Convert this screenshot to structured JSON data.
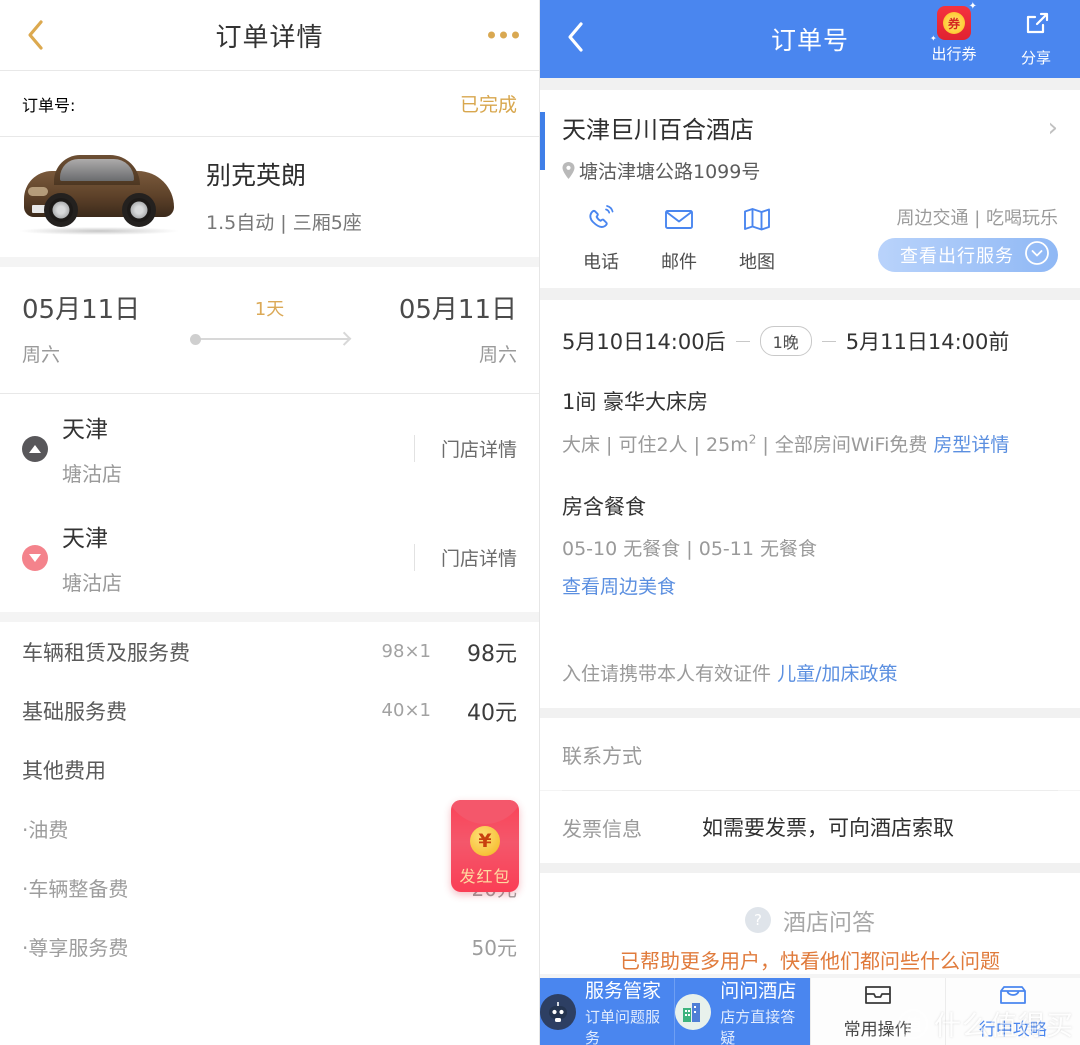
{
  "left": {
    "header": {
      "title": "订单详情",
      "back_icon": "chevron-left-icon",
      "menu_icon": "more-dots-icon"
    },
    "order": {
      "label": "订单号:",
      "status": "已完成"
    },
    "car": {
      "name": "别克英朗",
      "spec": "1.5自动 | 三厢5座",
      "photo_alt": "brown-buick-sedan"
    },
    "dates": {
      "start_date": "05月11日",
      "start_weekday": "周六",
      "duration": "1天",
      "end_date": "05月11日",
      "end_weekday": "周六"
    },
    "stores": [
      {
        "city": "天津",
        "name": "塘沽店",
        "detail": "门店详情",
        "type": "pickup"
      },
      {
        "city": "天津",
        "name": "塘沽店",
        "detail": "门店详情",
        "type": "dropoff"
      }
    ],
    "fees": [
      {
        "name": "车辆租赁及服务费",
        "qty": "98×1",
        "amount": "98元",
        "sub": false
      },
      {
        "name": "基础服务费",
        "qty": "40×1",
        "amount": "40元",
        "sub": false
      },
      {
        "name": "其他费用",
        "qty": "",
        "amount": "",
        "sub": false
      },
      {
        "name": "·油费",
        "qty": "",
        "amount": "-",
        "sub": true
      },
      {
        "name": "·车辆整备费",
        "qty": "",
        "amount": "20元",
        "sub": true
      },
      {
        "name": "·尊享服务费",
        "qty": "",
        "amount": "50元",
        "sub": true
      }
    ],
    "redpacket": {
      "label": "发红包",
      "coin": "¥"
    }
  },
  "right": {
    "header": {
      "title": "订单号",
      "back_icon": "chevron-left-icon",
      "coupon_label": "出行券",
      "coupon_glyph": "券",
      "share_label": "分享",
      "brand_color": "#4a86ef"
    },
    "hotel": {
      "name": "天津巨川百合酒店",
      "address": "塘沽津塘公路1099号",
      "actions": [
        {
          "label": "电话",
          "icon": "phone-icon"
        },
        {
          "label": "邮件",
          "icon": "mail-icon"
        },
        {
          "label": "地图",
          "icon": "map-icon"
        }
      ],
      "nearby": "周边交通 | 吃喝玩乐",
      "trip_service": "查看出行服务"
    },
    "stay": {
      "checkin": "5月10日14:00后",
      "nights": "1晚",
      "checkout": "5月11日14:00前",
      "room_title": "1间 豪华大床房",
      "room_spec_1": "大床 | 可住2人 | 25m",
      "room_spec_sup": "2",
      "room_spec_2": " | 全部房间WiFi免费",
      "room_detail_link": "房型详情"
    },
    "meal": {
      "title": "房含餐食",
      "detail": "05-10 无餐食 | 05-11 无餐食",
      "link": "查看周边美食"
    },
    "id_note": {
      "text": "入住请携带本人有效证件",
      "link": "儿童/加床政策"
    },
    "contact": {
      "key": "联系方式",
      "value": ""
    },
    "invoice": {
      "key": "发票信息",
      "value": "如需要发票，可向酒店索取"
    },
    "qa": {
      "title": "酒店问答",
      "subtitle": "已帮助更多用户，快看他们都问些什么问题"
    },
    "bottom_bar": [
      {
        "title": "服务管家",
        "subtitle": "订单问题服务",
        "style": "blue",
        "icon": "robot-icon"
      },
      {
        "title": "问问酒店",
        "subtitle": "店方直接答疑",
        "style": "blue",
        "icon": "hotel-building-icon"
      },
      {
        "title": "常用操作",
        "subtitle": "",
        "style": "white-dark",
        "icon": "inbox-icon"
      },
      {
        "title": "行中攻略",
        "subtitle": "",
        "style": "white-blue",
        "icon": "shop-icon"
      }
    ]
  },
  "watermark": {
    "badge": "值",
    "text": "什么值得买"
  }
}
